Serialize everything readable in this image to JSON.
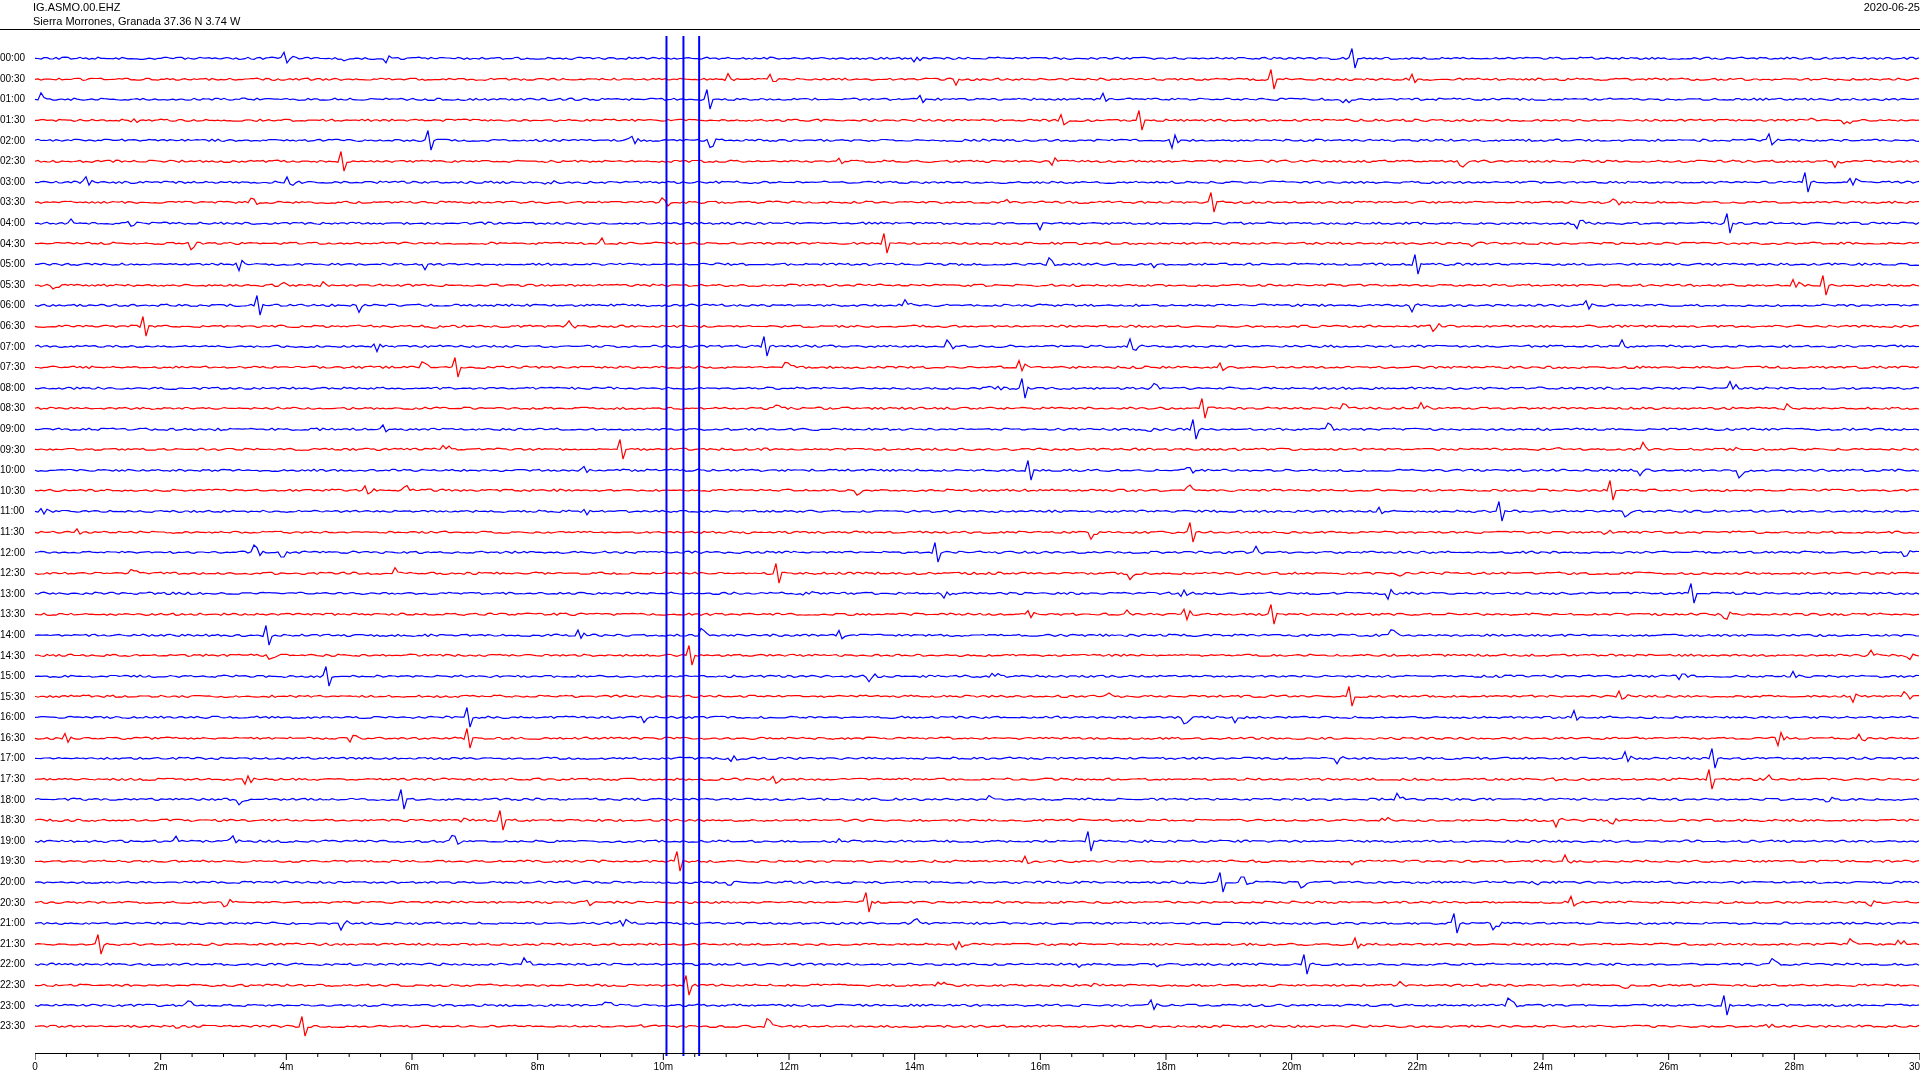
{
  "header": {
    "station": "IG.ASMO.00.EHZ",
    "location": "Sierra Morrones, Granada  37.36 N 3.74 W",
    "date": "2020-06-25"
  },
  "rows": [
    {
      "time": "00:00",
      "color": "#0000ff"
    },
    {
      "time": "00:30",
      "color": "#ff0000"
    },
    {
      "time": "01:00",
      "color": "#0000ff"
    },
    {
      "time": "01:30",
      "color": "#ff0000"
    },
    {
      "time": "02:00",
      "color": "#0000ff"
    },
    {
      "time": "02:30",
      "color": "#ff0000"
    },
    {
      "time": "03:00",
      "color": "#0000ff"
    },
    {
      "time": "03:30",
      "color": "#ff0000"
    },
    {
      "time": "04:00",
      "color": "#0000ff"
    },
    {
      "time": "04:30",
      "color": "#ff0000"
    },
    {
      "time": "05:00",
      "color": "#0000ff"
    },
    {
      "time": "05:30",
      "color": "#ff0000"
    },
    {
      "time": "06:00",
      "color": "#0000ff"
    },
    {
      "time": "06:30",
      "color": "#ff0000"
    },
    {
      "time": "07:00",
      "color": "#0000ff"
    },
    {
      "time": "07:30",
      "color": "#ff0000"
    },
    {
      "time": "08:00",
      "color": "#0000ff"
    },
    {
      "time": "08:30",
      "color": "#ff0000"
    },
    {
      "time": "09:00",
      "color": "#0000ff"
    },
    {
      "time": "09:30",
      "color": "#ff0000"
    },
    {
      "time": "10:00",
      "color": "#0000ff"
    },
    {
      "time": "10:30",
      "color": "#ff0000"
    },
    {
      "time": "11:00",
      "color": "#0000ff"
    },
    {
      "time": "11:30",
      "color": "#ff0000"
    },
    {
      "time": "12:00",
      "color": "#0000ff"
    },
    {
      "time": "12:30",
      "color": "#ff0000"
    },
    {
      "time": "13:00",
      "color": "#0000ff"
    },
    {
      "time": "13:30",
      "color": "#ff0000"
    },
    {
      "time": "14:00",
      "color": "#0000ff"
    },
    {
      "time": "14:30",
      "color": "#ff0000"
    },
    {
      "time": "15:00",
      "color": "#0000ff"
    },
    {
      "time": "15:30",
      "color": "#ff0000"
    },
    {
      "time": "16:00",
      "color": "#0000ff"
    },
    {
      "time": "16:30",
      "color": "#ff0000"
    },
    {
      "time": "17:00",
      "color": "#0000ff"
    },
    {
      "time": "17:30",
      "color": "#ff0000"
    },
    {
      "time": "18:00",
      "color": "#0000ff"
    },
    {
      "time": "18:30",
      "color": "#ff0000"
    },
    {
      "time": "19:00",
      "color": "#0000ff"
    },
    {
      "time": "19:30",
      "color": "#ff0000"
    },
    {
      "time": "20:00",
      "color": "#0000ff"
    },
    {
      "time": "20:30",
      "color": "#ff0000"
    },
    {
      "time": "21:00",
      "color": "#0000ff"
    },
    {
      "time": "21:30",
      "color": "#ff0000"
    },
    {
      "time": "22:00",
      "color": "#0000ff"
    },
    {
      "time": "22:30",
      "color": "#ff0000"
    },
    {
      "time": "23:00",
      "color": "#0000ff"
    },
    {
      "time": "23:30",
      "color": "#ff0000"
    }
  ],
  "axis_labels": [
    "0",
    "2m",
    "4m",
    "6m",
    "8m",
    "10m",
    "12m",
    "14m",
    "16m",
    "18m",
    "20m",
    "22m",
    "24m",
    "26m",
    "28m",
    "30"
  ]
}
